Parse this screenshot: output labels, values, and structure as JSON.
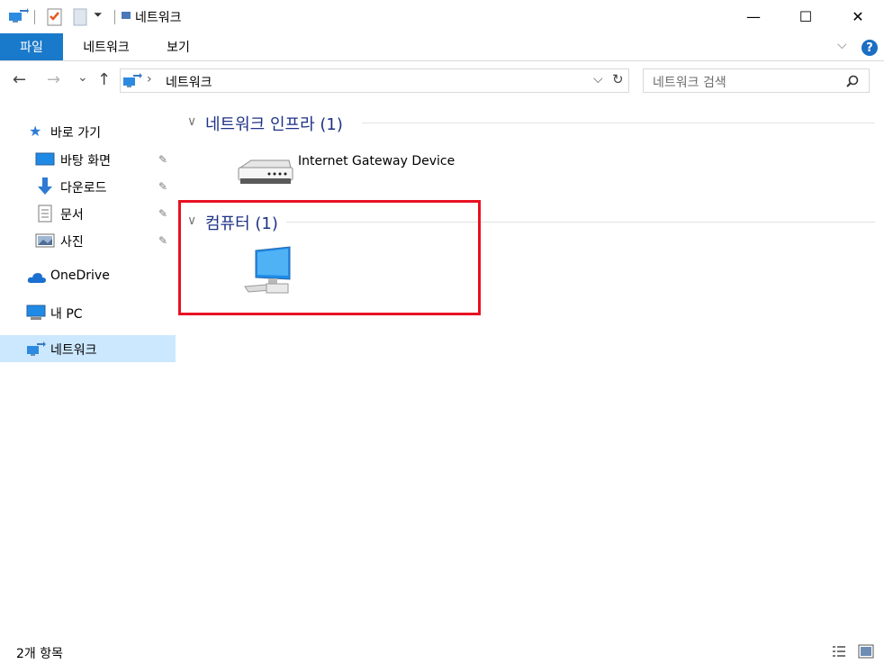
{
  "window": {
    "title": "네트워크",
    "minimize_glyph": "—",
    "maximize_glyph": "☐",
    "close_glyph": "✕"
  },
  "ribbon": {
    "tabs": [
      {
        "label": "파일",
        "active": true
      },
      {
        "label": "네트워크",
        "active": false
      },
      {
        "label": "보기",
        "active": false
      }
    ],
    "help_glyph": "?",
    "expand_glyph": "⌵"
  },
  "nav": {
    "back_glyph": "←",
    "forward_glyph": "→",
    "recent_glyph": "⌄",
    "up_glyph": "↑",
    "refresh_glyph": "↻",
    "dropdown_glyph": "⌵"
  },
  "address": {
    "separator": "›",
    "location": "네트워크"
  },
  "search": {
    "placeholder": "네트워크 검색"
  },
  "sidebar": {
    "quick_access": "바로 가기",
    "items": [
      {
        "label": "바탕 화면",
        "icon": "desktop-icon",
        "pinned": true
      },
      {
        "label": "다운로드",
        "icon": "download-icon",
        "pinned": true
      },
      {
        "label": "문서",
        "icon": "document-icon",
        "pinned": true
      },
      {
        "label": "사진",
        "icon": "picture-icon",
        "pinned": true
      }
    ],
    "onedrive": "OneDrive",
    "this_pc": "내 PC",
    "network": "네트워크",
    "pin_glyph": "📌"
  },
  "content": {
    "groups": [
      {
        "title": "네트워크 인프라 (1)",
        "items": [
          {
            "label": "Internet Gateway Device",
            "icon": "router-icon"
          }
        ]
      },
      {
        "title": "컴퓨터 (1)",
        "items": [
          {
            "label": "",
            "icon": "computer-icon"
          }
        ]
      }
    ],
    "collapse_glyph": "∨"
  },
  "status": {
    "text": "2개 항목"
  },
  "colors": {
    "accent": "#1979ca",
    "group_title": "#1e3287",
    "highlight": "#e81123",
    "selected": "#cce8ff"
  }
}
